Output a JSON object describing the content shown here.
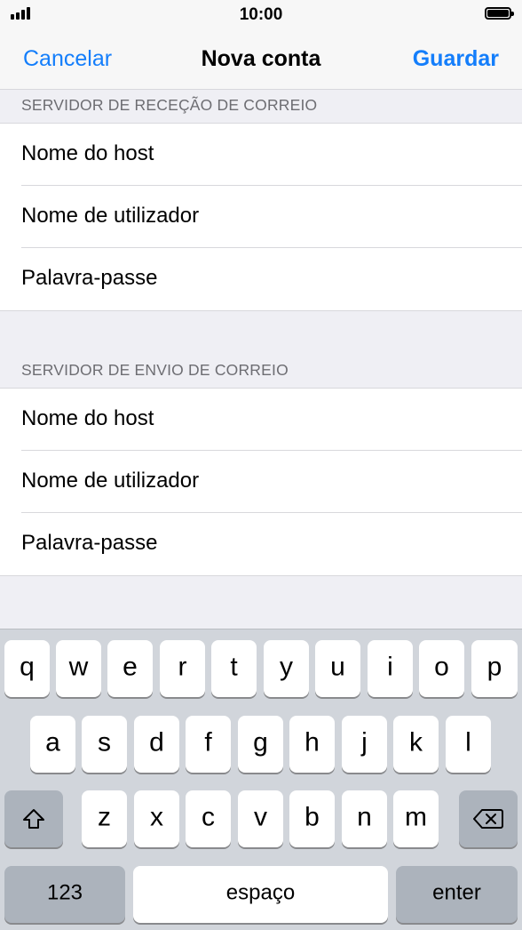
{
  "status_bar": {
    "time": "10:00"
  },
  "nav": {
    "cancel_label": "Cancelar",
    "title": "Nova conta",
    "save_label": "Guardar"
  },
  "incoming": {
    "header": "SERVIDOR DE RECEÇÃO DE CORREIO",
    "fields": [
      {
        "placeholder": "Nome do host"
      },
      {
        "placeholder": "Nome de utilizador"
      },
      {
        "placeholder": "Palavra-passe"
      }
    ]
  },
  "outgoing": {
    "header": "SERVIDOR DE ENVIO DE CORREIO",
    "fields": [
      {
        "placeholder": "Nome do host"
      },
      {
        "placeholder": "Nome de utilizador"
      },
      {
        "placeholder": "Palavra-passe"
      }
    ]
  },
  "keyboard": {
    "row1": [
      "q",
      "w",
      "e",
      "r",
      "t",
      "y",
      "u",
      "i",
      "o",
      "p"
    ],
    "row2": [
      "a",
      "s",
      "d",
      "f",
      "g",
      "h",
      "j",
      "k",
      "l"
    ],
    "row3": [
      "z",
      "x",
      "c",
      "v",
      "b",
      "n",
      "m"
    ],
    "numbers_label": "123",
    "space_label": "espaço",
    "enter_label": "enter",
    "shift_icon": "shift-icon",
    "delete_icon": "backspace-icon"
  }
}
